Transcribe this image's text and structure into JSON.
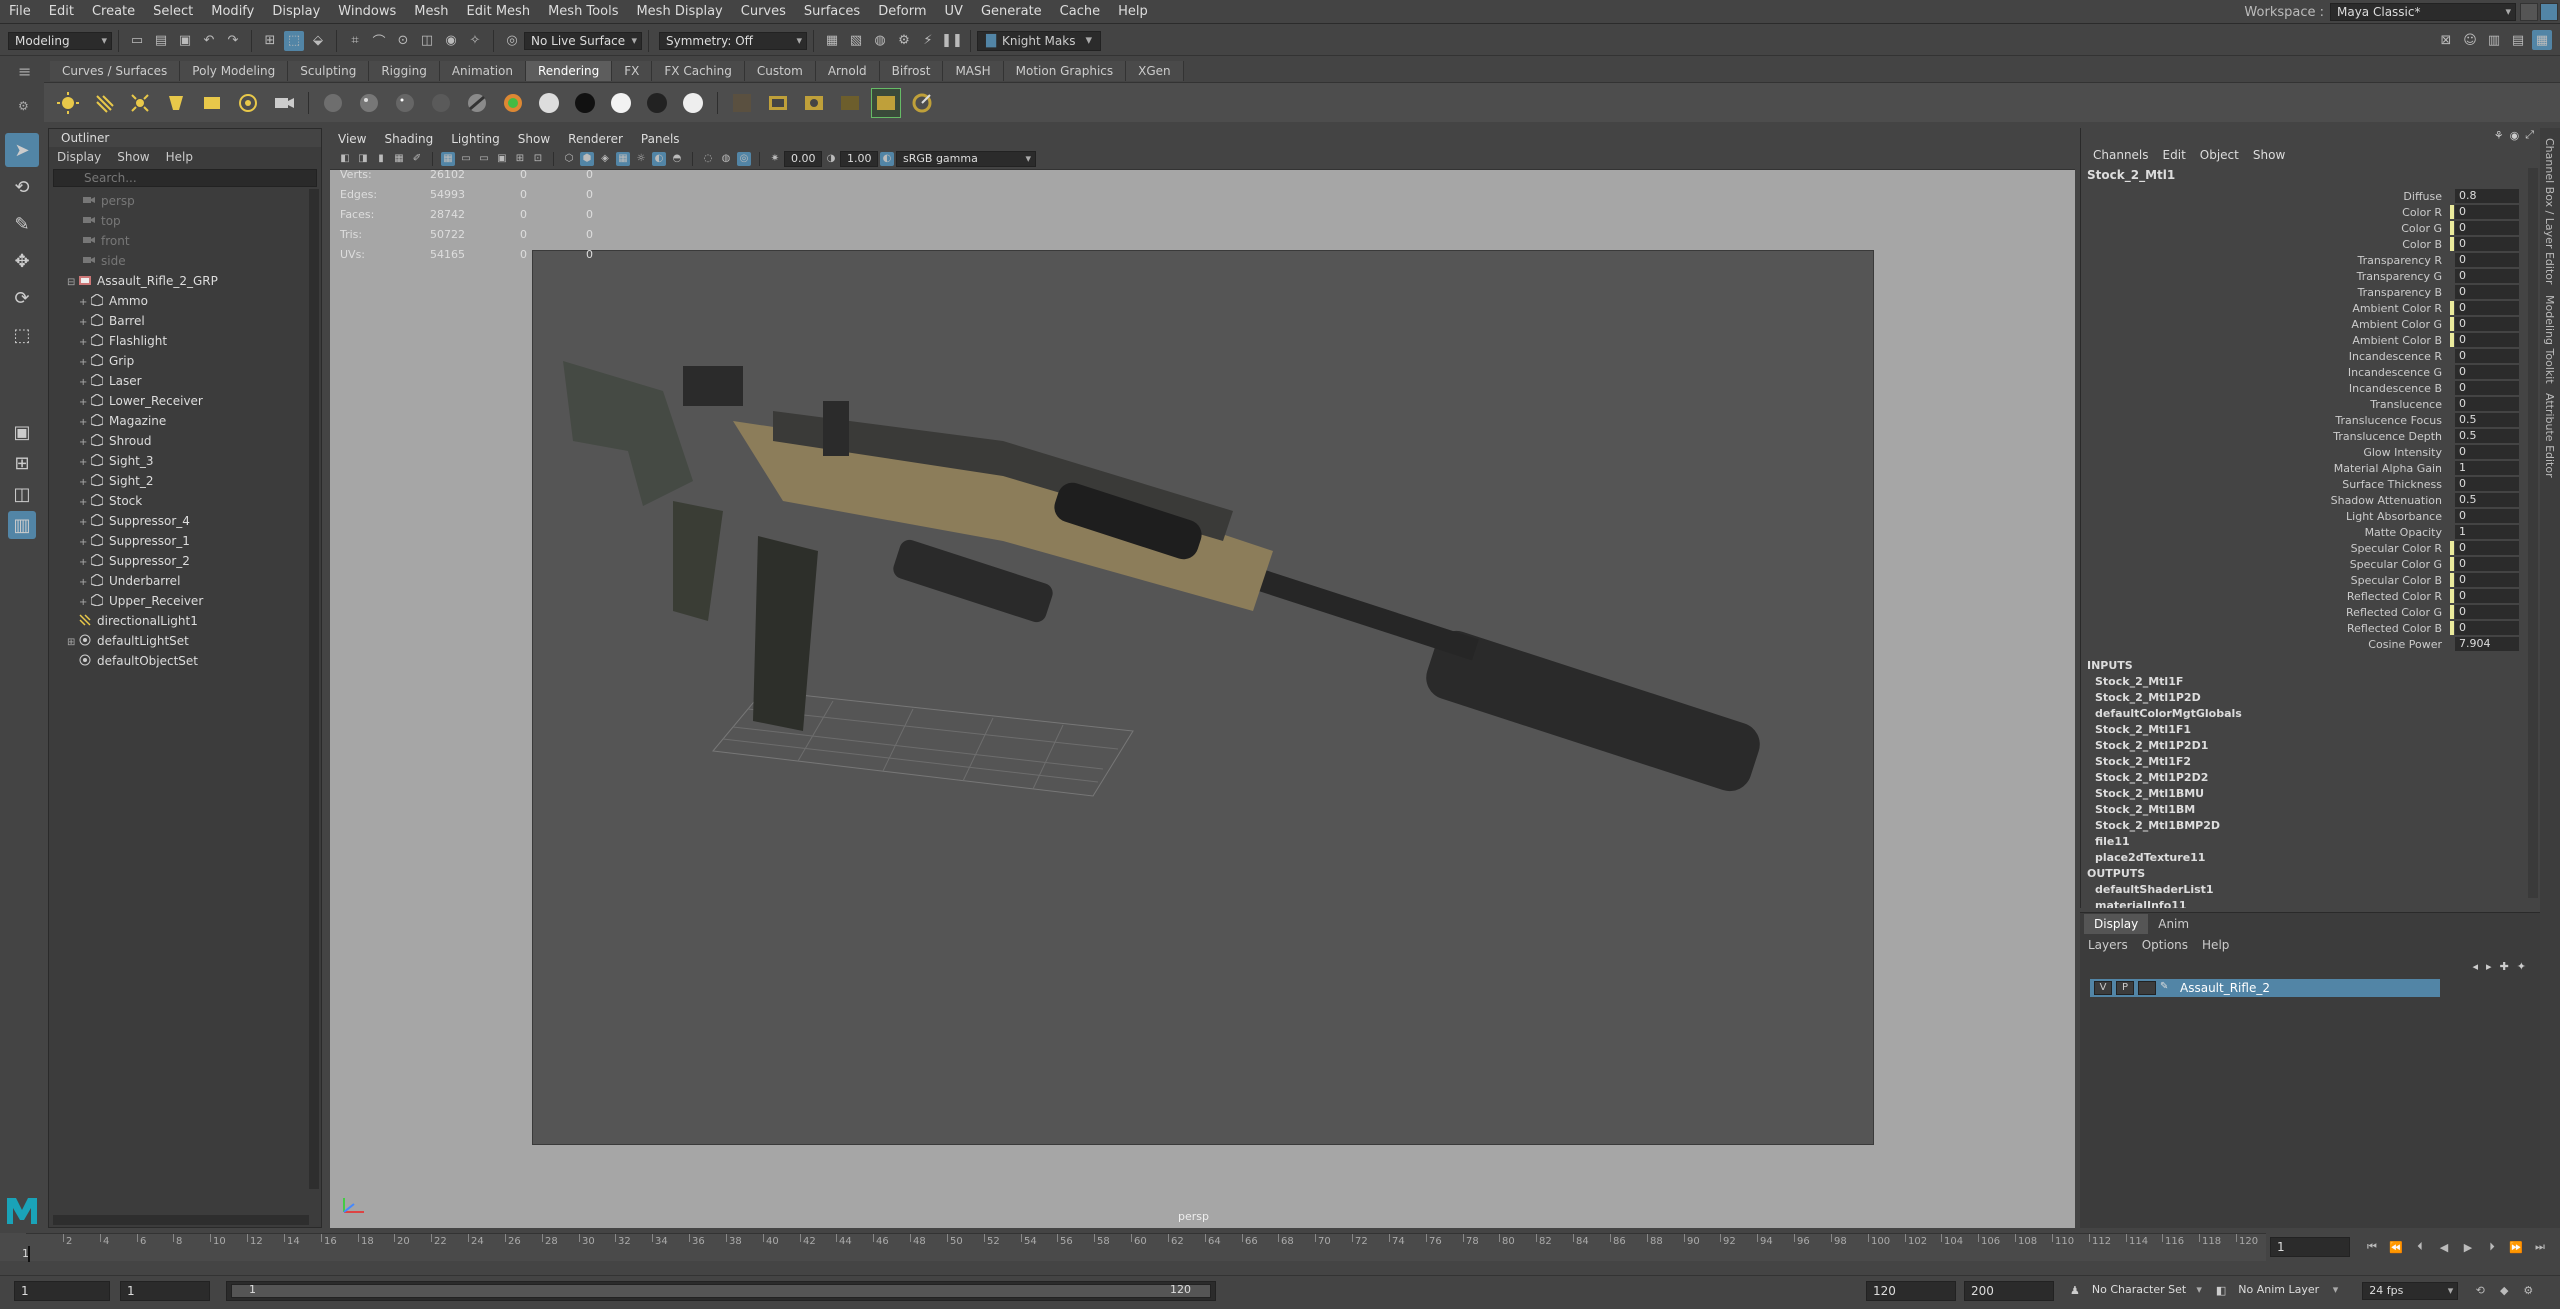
{
  "menubar": {
    "items": [
      "File",
      "Edit",
      "Create",
      "Select",
      "Modify",
      "Display",
      "Windows",
      "Mesh",
      "Edit Mesh",
      "Mesh Tools",
      "Mesh Display",
      "Curves",
      "Surfaces",
      "Deform",
      "UV",
      "Generate",
      "Cache",
      "Help"
    ],
    "workspace_label": "Workspace :",
    "workspace_value": "Maya Classic*"
  },
  "statusline": {
    "menuset": "Modeling",
    "live_surface": "No Live Surface",
    "symmetry": "Symmetry: Off",
    "user": "Knight Maks"
  },
  "shelf": {
    "tabs": [
      "Curves / Surfaces",
      "Poly Modeling",
      "Sculpting",
      "Rigging",
      "Animation",
      "Rendering",
      "FX",
      "FX Caching",
      "Custom",
      "Arnold",
      "Bifrost",
      "MASH",
      "Motion Graphics",
      "XGen"
    ],
    "active_tab": "Rendering"
  },
  "outliner": {
    "title": "Outliner",
    "menus": [
      "Display",
      "Show",
      "Help"
    ],
    "search_placeholder": "Search...",
    "cameras": [
      "persp",
      "top",
      "front",
      "side"
    ],
    "group": "Assault_Rifle_2_GRP",
    "children": [
      "Ammo",
      "Barrel",
      "Flashlight",
      "Grip",
      "Laser",
      "Lower_Receiver",
      "Magazine",
      "Shroud",
      "Sight_3",
      "Sight_2",
      "Stock",
      "Suppressor_4",
      "Suppressor_1",
      "Suppressor_2",
      "Underbarrel",
      "Upper_Receiver"
    ],
    "others": [
      "directionalLight1",
      "defaultLightSet",
      "defaultObjectSet"
    ]
  },
  "viewport": {
    "menus": [
      "View",
      "Shading",
      "Lighting",
      "Show",
      "Renderer",
      "Panels"
    ],
    "exposure": "0.00",
    "gamma": "1.00",
    "colorspace": "sRGB gamma",
    "camera": "persp",
    "hud": [
      {
        "label": "Verts:",
        "v1": "26102",
        "v2": "0",
        "v3": "0"
      },
      {
        "label": "Edges:",
        "v1": "54993",
        "v2": "0",
        "v3": "0"
      },
      {
        "label": "Faces:",
        "v1": "28742",
        "v2": "0",
        "v3": "0"
      },
      {
        "label": "Tris:",
        "v1": "50722",
        "v2": "0",
        "v3": "0"
      },
      {
        "label": "UVs:",
        "v1": "54165",
        "v2": "0",
        "v3": "0"
      }
    ]
  },
  "channelbox": {
    "menus": [
      "Channels",
      "Edit",
      "Object",
      "Show"
    ],
    "object": "Stock_2_Mtl1",
    "attributes": [
      {
        "name": "Diffuse",
        "value": "0.8",
        "key": false
      },
      {
        "name": "Color R",
        "value": "0",
        "key": true
      },
      {
        "name": "Color G",
        "value": "0",
        "key": true
      },
      {
        "name": "Color B",
        "value": "0",
        "key": true
      },
      {
        "name": "Transparency R",
        "value": "0",
        "key": false
      },
      {
        "name": "Transparency G",
        "value": "0",
        "key": false
      },
      {
        "name": "Transparency B",
        "value": "0",
        "key": false
      },
      {
        "name": "Ambient Color R",
        "value": "0",
        "key": true
      },
      {
        "name": "Ambient Color G",
        "value": "0",
        "key": true
      },
      {
        "name": "Ambient Color B",
        "value": "0",
        "key": true
      },
      {
        "name": "Incandescence R",
        "value": "0",
        "key": false
      },
      {
        "name": "Incandescence G",
        "value": "0",
        "key": false
      },
      {
        "name": "Incandescence B",
        "value": "0",
        "key": false
      },
      {
        "name": "Translucence",
        "value": "0",
        "key": false
      },
      {
        "name": "Translucence Focus",
        "value": "0.5",
        "key": false
      },
      {
        "name": "Translucence Depth",
        "value": "0.5",
        "key": false
      },
      {
        "name": "Glow Intensity",
        "value": "0",
        "key": false
      },
      {
        "name": "Material Alpha Gain",
        "value": "1",
        "key": false
      },
      {
        "name": "Surface Thickness",
        "value": "0",
        "key": false
      },
      {
        "name": "Shadow Attenuation",
        "value": "0.5",
        "key": false
      },
      {
        "name": "Light Absorbance",
        "value": "0",
        "key": false
      },
      {
        "name": "Matte Opacity",
        "value": "1",
        "key": false
      },
      {
        "name": "Specular Color R",
        "value": "0",
        "key": true
      },
      {
        "name": "Specular Color G",
        "value": "0",
        "key": true
      },
      {
        "name": "Specular Color B",
        "value": "0",
        "key": true
      },
      {
        "name": "Reflected Color R",
        "value": "0",
        "key": true
      },
      {
        "name": "Reflected Color G",
        "value": "0",
        "key": true
      },
      {
        "name": "Reflected Color B",
        "value": "0",
        "key": true
      },
      {
        "name": "Cosine Power",
        "value": "7.904",
        "key": false
      }
    ],
    "inputs_label": "INPUTS",
    "inputs": [
      "Stock_2_Mtl1F",
      "Stock_2_Mtl1P2D",
      "defaultColorMgtGlobals",
      "Stock_2_Mtl1F1",
      "Stock_2_Mtl1P2D1",
      "Stock_2_Mtl1F2",
      "Stock_2_Mtl1P2D2",
      "Stock_2_Mtl1BMU",
      "Stock_2_Mtl1BM",
      "Stock_2_Mtl1BMP2D",
      "file11",
      "place2dTexture11"
    ],
    "outputs_label": "OUTPUTS",
    "outputs": [
      "defaultShaderList1",
      "materialInfo11"
    ]
  },
  "layereditor": {
    "tabs": [
      "Display",
      "Anim"
    ],
    "menus": [
      "Layers",
      "Options",
      "Help"
    ],
    "layer_v": "V",
    "layer_p": "P",
    "layer_name": "Assault_Rifle_2"
  },
  "sidetabs": [
    "Channel Box / Layer Editor",
    "Modeling Toolkit",
    "Attribute Editor"
  ],
  "timeline": {
    "ticks": [
      "2",
      "4",
      "6",
      "8",
      "10",
      "12",
      "14",
      "16",
      "18",
      "20",
      "22",
      "24",
      "26",
      "28",
      "30",
      "32",
      "34",
      "36",
      "38",
      "40",
      "42",
      "44",
      "46",
      "48",
      "50",
      "52",
      "54",
      "56",
      "58",
      "60",
      "62",
      "64",
      "66",
      "68",
      "70",
      "72",
      "74",
      "76",
      "78",
      "80",
      "82",
      "84",
      "86",
      "88",
      "90",
      "92",
      "94",
      "96",
      "98",
      "100",
      "102",
      "104",
      "106",
      "108",
      "110",
      "112",
      "114",
      "116",
      "118",
      "120"
    ],
    "current": "1",
    "current_field": "1"
  },
  "range": {
    "start": "1",
    "playback_start": "1",
    "slider_start": "1",
    "slider_end": "120",
    "playback_end": "120",
    "end": "200",
    "character_set": "No Character Set",
    "anim_layer": "No Anim Layer",
    "fps": "24 fps"
  },
  "colors": {
    "accent": "#5285a6",
    "keyed": "#ebeb9c"
  }
}
